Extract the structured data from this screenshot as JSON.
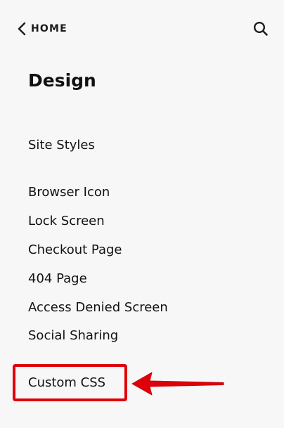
{
  "header": {
    "back_label": "HOME",
    "back_icon": "chevron-left-icon",
    "search_icon": "search-icon"
  },
  "title": "Design",
  "menu": {
    "site_styles": "Site Styles",
    "items": [
      "Browser Icon",
      "Lock Screen",
      "Checkout Page",
      "404 Page",
      "Access Denied Screen",
      "Social Sharing"
    ],
    "custom_css": "Custom CSS"
  },
  "colors": {
    "panel_background": "#f7f7f7",
    "text": "#111111",
    "highlight": "#e0000c"
  }
}
